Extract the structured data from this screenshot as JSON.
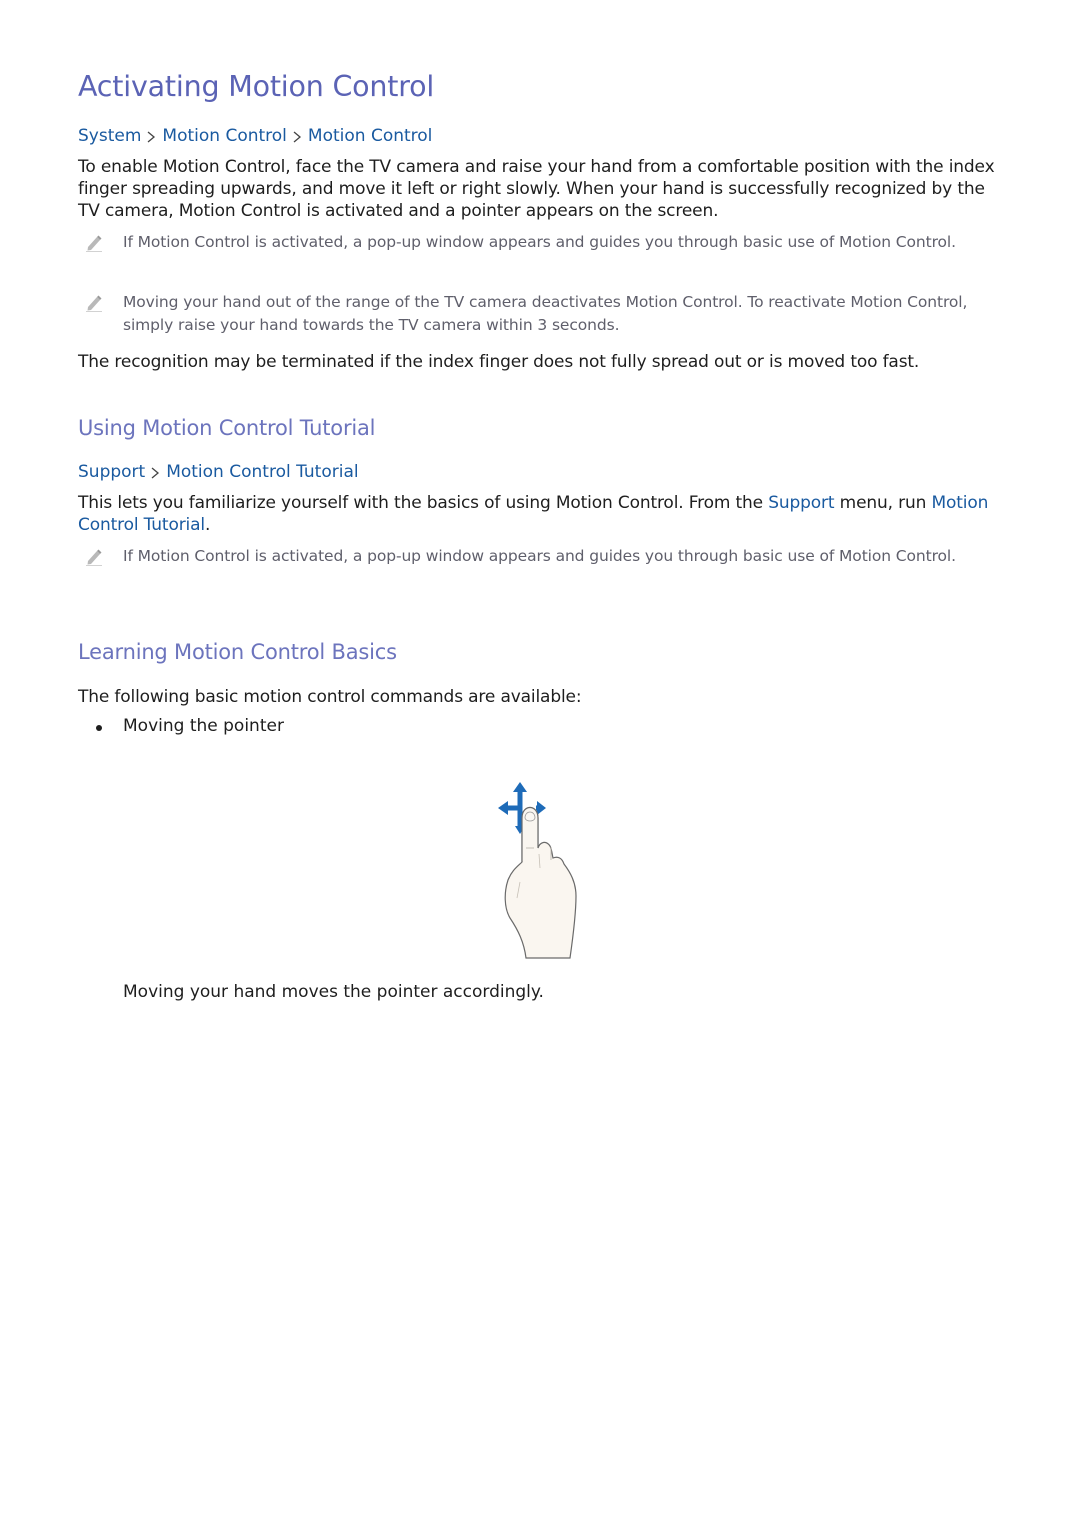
{
  "section": {
    "title": "Activating Motion Control",
    "path": [
      "System",
      "Motion Control",
      "Motion Control"
    ],
    "body": "To enable Motion Control, face the TV camera and raise your hand from a comfortable position with the index finger spreading upwards, and move it left or right slowly. When your hand is successfully recognized by the TV camera, Motion Control is activated and a pointer appears on the screen.",
    "notes": [
      "If Motion Control is activated, a pop-up window appears and guides you through basic use of Motion Control.",
      "Moving your hand out of the range of the TV camera deactivates Motion Control. To reactivate Motion Control, simply raise your hand towards the TV camera within 3 seconds."
    ],
    "footer": "The recognition may be terminated if the index finger does not fully spread out or is moved too fast."
  },
  "tutorial": {
    "title": "Using Motion Control Tutorial",
    "path": [
      "Support",
      "Motion Control Tutorial"
    ],
    "body_before": "This lets you familiarize yourself with the basics of using Motion Control. From the ",
    "link_support": "Support",
    "body_middle": " menu, run ",
    "link_tutorial": "Motion Control Tutorial",
    "body_after": ".",
    "note": "If Motion Control is activated, a pop-up window appears and guides you through basic use of Motion Control."
  },
  "basics": {
    "title": "Learning Motion Control Basics",
    "intro": "The following basic motion control commands are available:",
    "bullet": "Moving the pointer",
    "figure_icon": "hand-pointer-move-icon",
    "caption": "Moving your hand moves the pointer accordingly."
  },
  "colors": {
    "heading": "#5b63b5",
    "subheading": "#6c74bd",
    "link": "#1a5aa0",
    "note_text": "#5f5f6b",
    "arrow": "#1e6bb8"
  }
}
